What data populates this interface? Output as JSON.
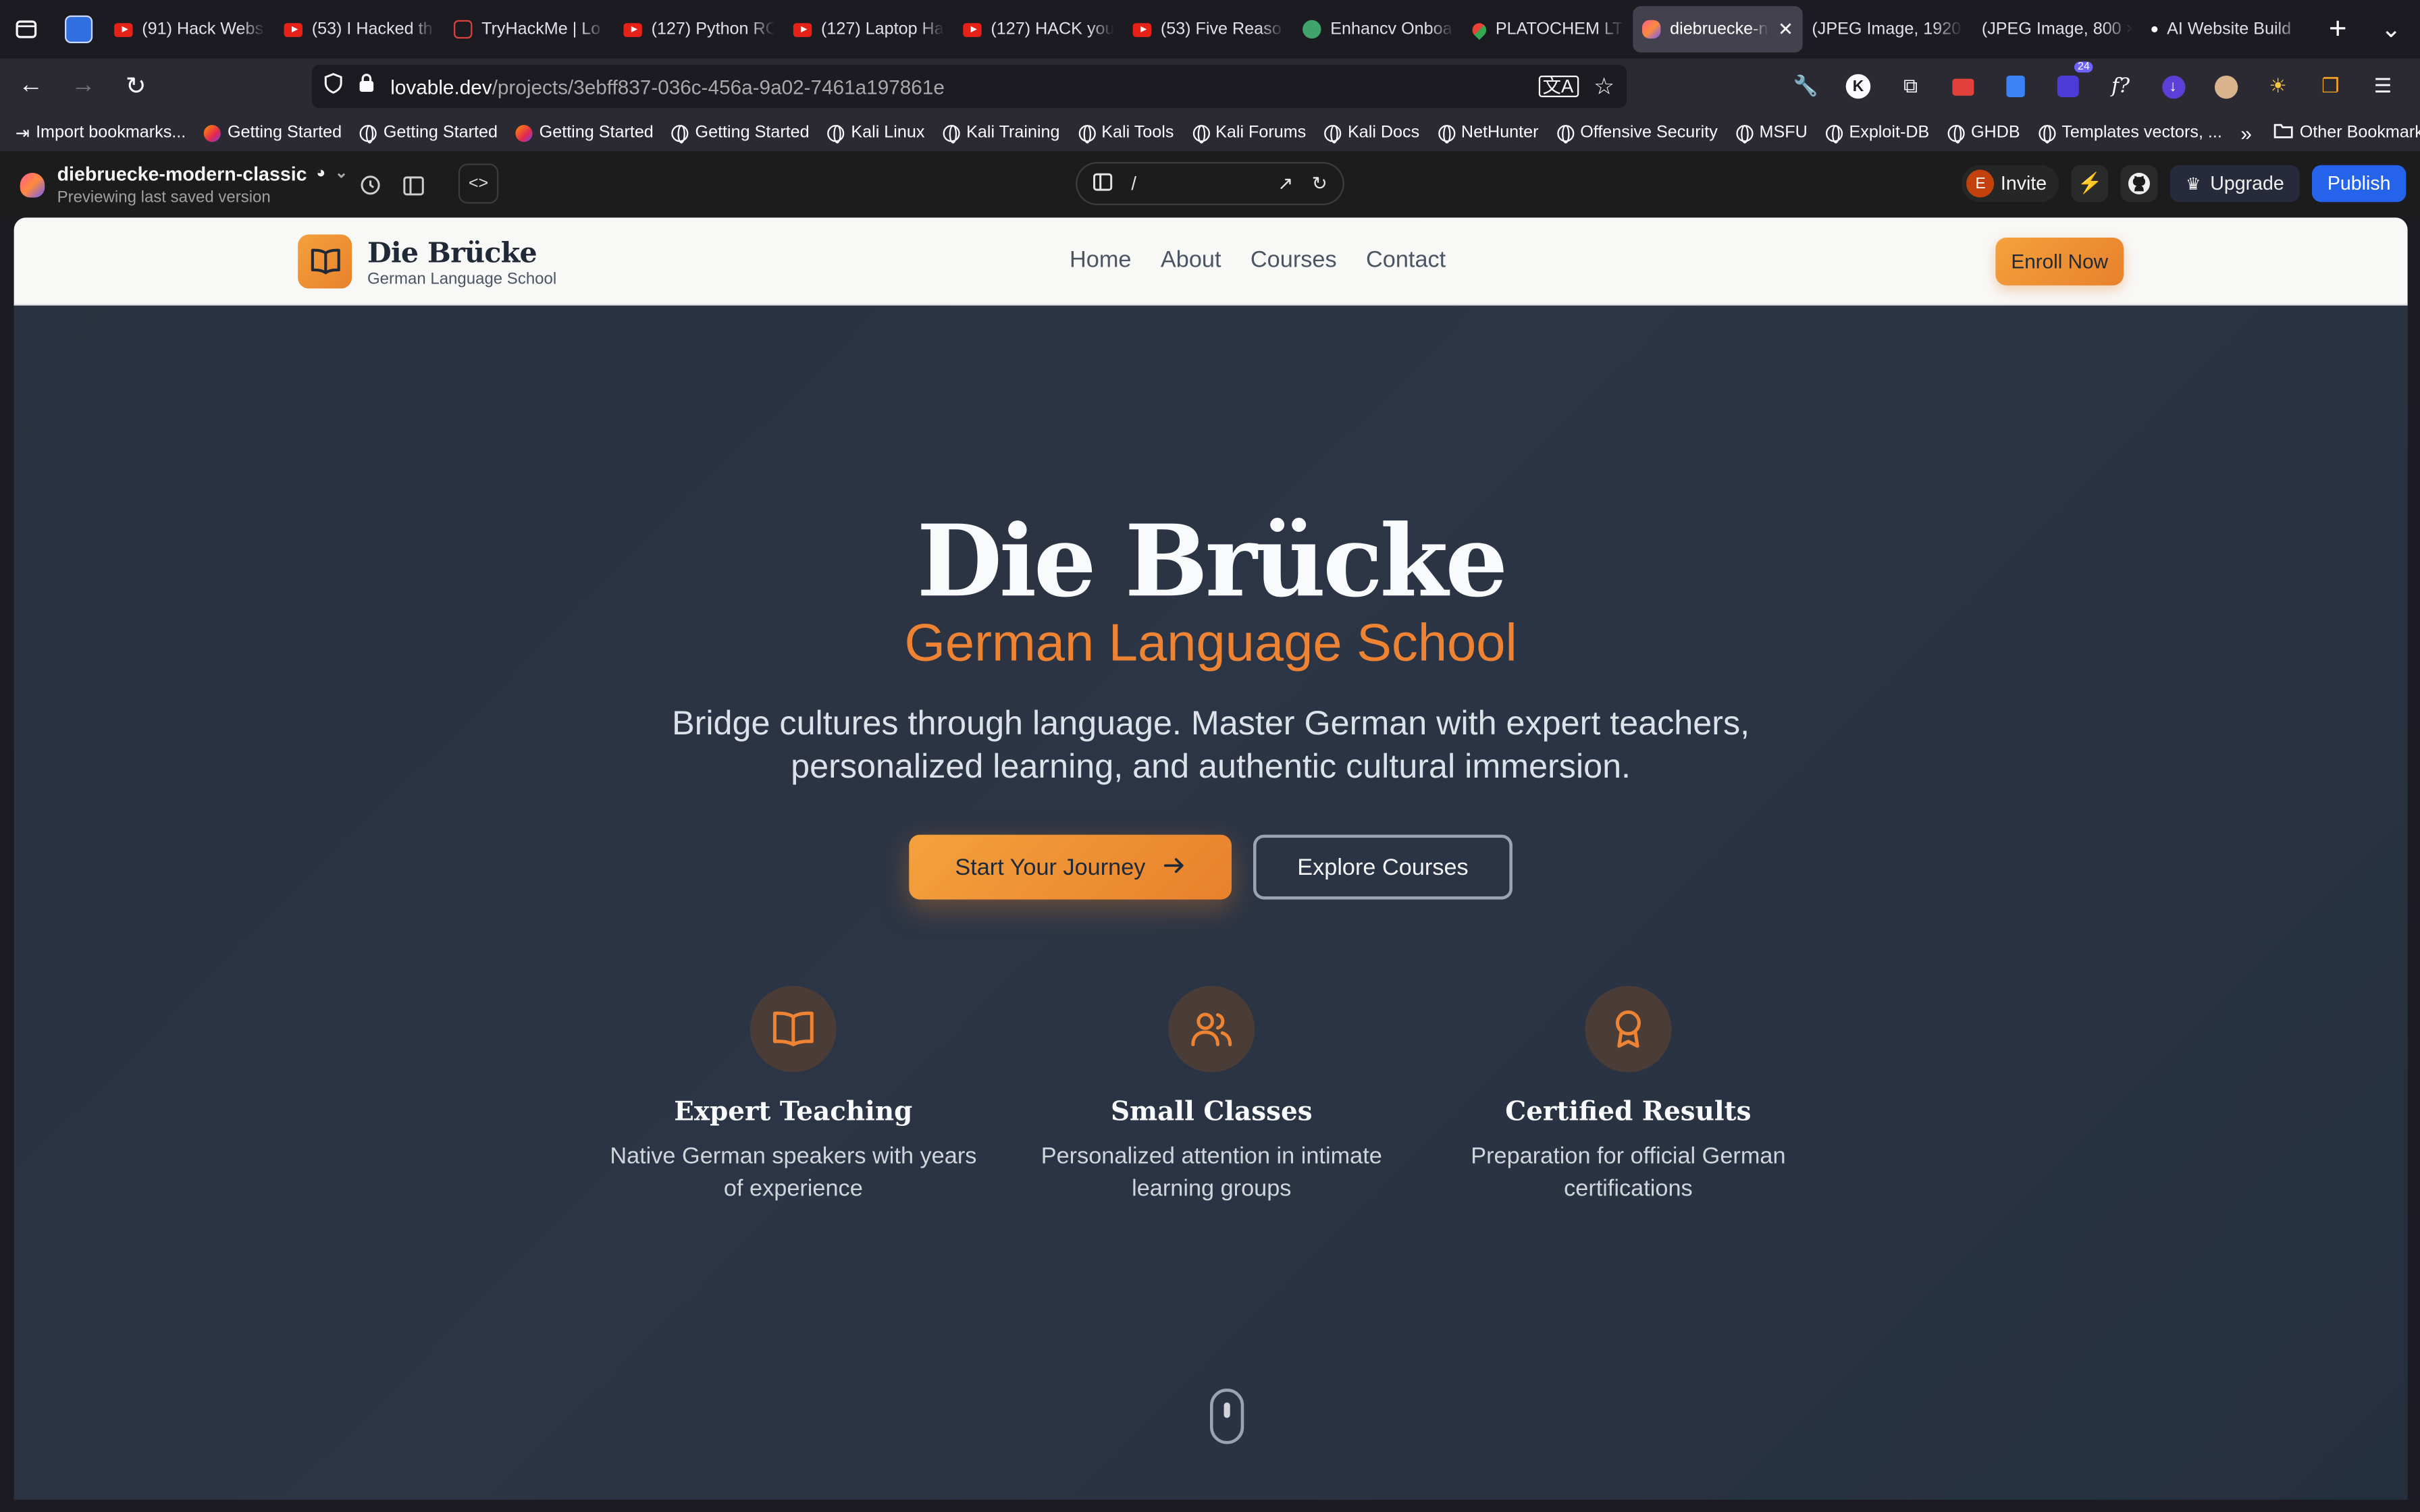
{
  "browser": {
    "tabs": [
      {
        "label": "(91) Hack Webs",
        "icon": "youtube-icon"
      },
      {
        "label": "(53) I Hacked th",
        "icon": "youtube-icon"
      },
      {
        "label": "TryHackMe | Lo",
        "icon": "tryhackme-icon"
      },
      {
        "label": "(127) Python RC",
        "icon": "youtube-icon"
      },
      {
        "label": "(127) Laptop Ha",
        "icon": "youtube-icon"
      },
      {
        "label": "(127) HACK you",
        "icon": "youtube-icon"
      },
      {
        "label": "(53) Five Reaso",
        "icon": "youtube-icon"
      },
      {
        "label": "Enhancv Onboa",
        "icon": "enhancv-icon"
      },
      {
        "label": "PLATOCHEM LT",
        "icon": "maps-icon"
      },
      {
        "label": "diebruecke-n",
        "icon": "lovable-icon",
        "active": true
      },
      {
        "label": "(JPEG Image, 1920",
        "icon": "none"
      },
      {
        "label": "(JPEG Image, 800 ×",
        "icon": "none"
      },
      {
        "label": "AI Website Build",
        "icon": "dot-icon"
      }
    ],
    "url_host": "lovable.dev",
    "url_path": "/projects/3ebff837-036c-456a-9a02-7461a197861e",
    "extension_badge": "24",
    "bookmarks": [
      "Import bookmarks...",
      "Getting Started",
      "Getting Started",
      "Getting Started",
      "Getting Started",
      "Kali Linux",
      "Kali Training",
      "Kali Tools",
      "Kali Forums",
      "Kali Docs",
      "NetHunter",
      "Offensive Security",
      "MSFU",
      "Exploit-DB",
      "GHDB",
      "Templates vectors, ..."
    ],
    "other_bookmarks": "Other Bookmarks"
  },
  "lovable": {
    "project_name": "diebruecke-modern-classic",
    "status": "Previewing last saved version",
    "path": "/",
    "avatar_letter": "E",
    "invite": "Invite",
    "upgrade": "Upgrade",
    "publish": "Publish"
  },
  "site": {
    "brand": "Die Brücke",
    "brand_sub": "German Language School",
    "menu": [
      "Home",
      "About",
      "Courses",
      "Contact"
    ],
    "cta": "Enroll Now",
    "hero_title": "Die Brücke",
    "hero_subtitle": "German Language School",
    "hero_desc_line1": "Bridge cultures through language. Master German with expert teachers,",
    "hero_desc_line2": "personalized learning, and authentic cultural immersion.",
    "primary_btn": "Start Your Journey",
    "secondary_btn": "Explore Courses",
    "features": [
      {
        "title": "Expert Teaching",
        "line1": "Native German speakers with years",
        "line2": "of experience",
        "icon": "book-open-icon"
      },
      {
        "title": "Small Classes",
        "line1": "Personalized attention in intimate",
        "line2": "learning groups",
        "icon": "users-icon"
      },
      {
        "title": "Certified Results",
        "line1": "Preparation for official German",
        "line2": "certifications",
        "icon": "award-icon"
      }
    ]
  },
  "colors": {
    "accent_orange": "#ee8333",
    "publish_blue": "#2563eb",
    "hero_bg": "#2c3545"
  }
}
